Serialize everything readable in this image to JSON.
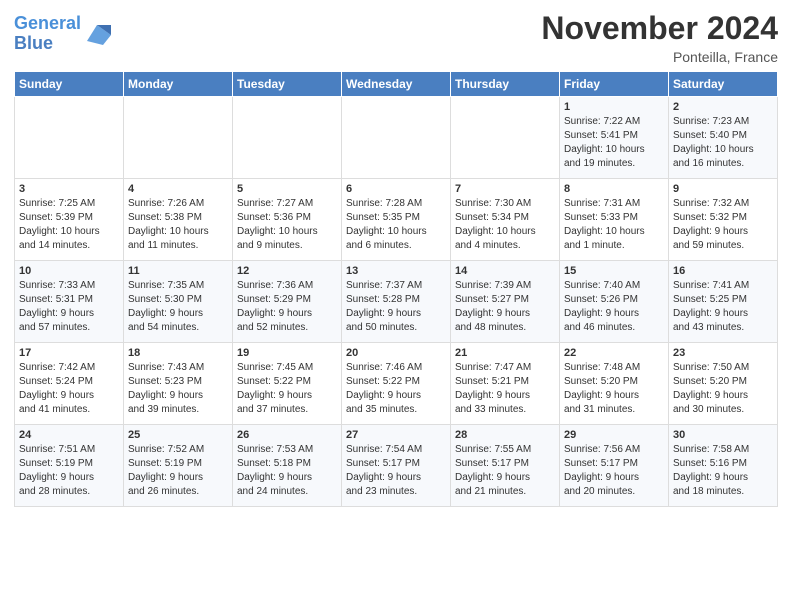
{
  "header": {
    "logo_line1": "General",
    "logo_line2": "Blue",
    "title": "November 2024",
    "location": "Ponteilla, France"
  },
  "weekdays": [
    "Sunday",
    "Monday",
    "Tuesday",
    "Wednesday",
    "Thursday",
    "Friday",
    "Saturday"
  ],
  "weeks": [
    [
      {
        "day": "",
        "info": ""
      },
      {
        "day": "",
        "info": ""
      },
      {
        "day": "",
        "info": ""
      },
      {
        "day": "",
        "info": ""
      },
      {
        "day": "",
        "info": ""
      },
      {
        "day": "1",
        "info": "Sunrise: 7:22 AM\nSunset: 5:41 PM\nDaylight: 10 hours\nand 19 minutes."
      },
      {
        "day": "2",
        "info": "Sunrise: 7:23 AM\nSunset: 5:40 PM\nDaylight: 10 hours\nand 16 minutes."
      }
    ],
    [
      {
        "day": "3",
        "info": "Sunrise: 7:25 AM\nSunset: 5:39 PM\nDaylight: 10 hours\nand 14 minutes."
      },
      {
        "day": "4",
        "info": "Sunrise: 7:26 AM\nSunset: 5:38 PM\nDaylight: 10 hours\nand 11 minutes."
      },
      {
        "day": "5",
        "info": "Sunrise: 7:27 AM\nSunset: 5:36 PM\nDaylight: 10 hours\nand 9 minutes."
      },
      {
        "day": "6",
        "info": "Sunrise: 7:28 AM\nSunset: 5:35 PM\nDaylight: 10 hours\nand 6 minutes."
      },
      {
        "day": "7",
        "info": "Sunrise: 7:30 AM\nSunset: 5:34 PM\nDaylight: 10 hours\nand 4 minutes."
      },
      {
        "day": "8",
        "info": "Sunrise: 7:31 AM\nSunset: 5:33 PM\nDaylight: 10 hours\nand 1 minute."
      },
      {
        "day": "9",
        "info": "Sunrise: 7:32 AM\nSunset: 5:32 PM\nDaylight: 9 hours\nand 59 minutes."
      }
    ],
    [
      {
        "day": "10",
        "info": "Sunrise: 7:33 AM\nSunset: 5:31 PM\nDaylight: 9 hours\nand 57 minutes."
      },
      {
        "day": "11",
        "info": "Sunrise: 7:35 AM\nSunset: 5:30 PM\nDaylight: 9 hours\nand 54 minutes."
      },
      {
        "day": "12",
        "info": "Sunrise: 7:36 AM\nSunset: 5:29 PM\nDaylight: 9 hours\nand 52 minutes."
      },
      {
        "day": "13",
        "info": "Sunrise: 7:37 AM\nSunset: 5:28 PM\nDaylight: 9 hours\nand 50 minutes."
      },
      {
        "day": "14",
        "info": "Sunrise: 7:39 AM\nSunset: 5:27 PM\nDaylight: 9 hours\nand 48 minutes."
      },
      {
        "day": "15",
        "info": "Sunrise: 7:40 AM\nSunset: 5:26 PM\nDaylight: 9 hours\nand 46 minutes."
      },
      {
        "day": "16",
        "info": "Sunrise: 7:41 AM\nSunset: 5:25 PM\nDaylight: 9 hours\nand 43 minutes."
      }
    ],
    [
      {
        "day": "17",
        "info": "Sunrise: 7:42 AM\nSunset: 5:24 PM\nDaylight: 9 hours\nand 41 minutes."
      },
      {
        "day": "18",
        "info": "Sunrise: 7:43 AM\nSunset: 5:23 PM\nDaylight: 9 hours\nand 39 minutes."
      },
      {
        "day": "19",
        "info": "Sunrise: 7:45 AM\nSunset: 5:22 PM\nDaylight: 9 hours\nand 37 minutes."
      },
      {
        "day": "20",
        "info": "Sunrise: 7:46 AM\nSunset: 5:22 PM\nDaylight: 9 hours\nand 35 minutes."
      },
      {
        "day": "21",
        "info": "Sunrise: 7:47 AM\nSunset: 5:21 PM\nDaylight: 9 hours\nand 33 minutes."
      },
      {
        "day": "22",
        "info": "Sunrise: 7:48 AM\nSunset: 5:20 PM\nDaylight: 9 hours\nand 31 minutes."
      },
      {
        "day": "23",
        "info": "Sunrise: 7:50 AM\nSunset: 5:20 PM\nDaylight: 9 hours\nand 30 minutes."
      }
    ],
    [
      {
        "day": "24",
        "info": "Sunrise: 7:51 AM\nSunset: 5:19 PM\nDaylight: 9 hours\nand 28 minutes."
      },
      {
        "day": "25",
        "info": "Sunrise: 7:52 AM\nSunset: 5:19 PM\nDaylight: 9 hours\nand 26 minutes."
      },
      {
        "day": "26",
        "info": "Sunrise: 7:53 AM\nSunset: 5:18 PM\nDaylight: 9 hours\nand 24 minutes."
      },
      {
        "day": "27",
        "info": "Sunrise: 7:54 AM\nSunset: 5:17 PM\nDaylight: 9 hours\nand 23 minutes."
      },
      {
        "day": "28",
        "info": "Sunrise: 7:55 AM\nSunset: 5:17 PM\nDaylight: 9 hours\nand 21 minutes."
      },
      {
        "day": "29",
        "info": "Sunrise: 7:56 AM\nSunset: 5:17 PM\nDaylight: 9 hours\nand 20 minutes."
      },
      {
        "day": "30",
        "info": "Sunrise: 7:58 AM\nSunset: 5:16 PM\nDaylight: 9 hours\nand 18 minutes."
      }
    ]
  ]
}
